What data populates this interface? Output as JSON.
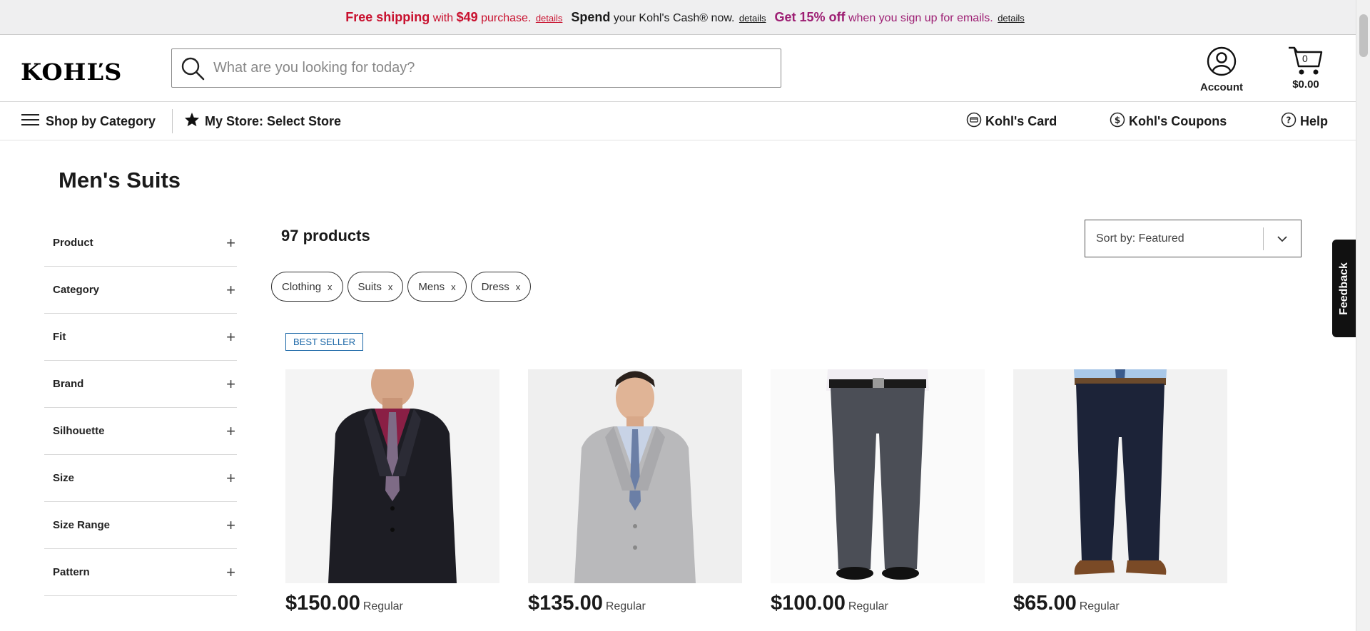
{
  "promo": {
    "seg1_strong": "Free shipping",
    "seg1_mid": "with",
    "seg1_amount": "$49",
    "seg1_end": "purchase.",
    "seg1_link": "details",
    "seg2_strong": "Spend",
    "seg2_mid": "your Kohl's Cash® now.",
    "seg2_link": "details",
    "seg3_strong": "Get 15% off",
    "seg3_mid": "when you sign up for emails.",
    "seg3_link": "details"
  },
  "header": {
    "logo": "KOHĽS",
    "search_placeholder": "What are you looking for today?",
    "account_label": "Account",
    "cart_count": "0",
    "cart_total": "$0.00"
  },
  "nav": {
    "shop_by_category": "Shop by Category",
    "my_store": "My Store: Select Store",
    "kohls_card": "Kohl's Card",
    "kohls_coupons": "Kohl's Coupons",
    "help": "Help"
  },
  "page_title": "Men's Suits",
  "facets": [
    "Product",
    "Category",
    "Fit",
    "Brand",
    "Silhouette",
    "Size",
    "Size Range",
    "Pattern"
  ],
  "product_count": "97 products",
  "sort_label": "Sort by: Featured",
  "chips": [
    "Clothing",
    "Suits",
    "Mens",
    "Dress"
  ],
  "chip_remove": "x",
  "badge": "BEST SELLER",
  "products": [
    {
      "price": "$150.00",
      "price_type": "Regular"
    },
    {
      "price": "$135.00",
      "price_type": "Regular"
    },
    {
      "price": "$100.00",
      "price_type": "Regular"
    },
    {
      "price": "$65.00",
      "price_type": "Regular"
    }
  ],
  "feedback_label": "Feedback",
  "colors": {
    "promo_red": "#c8102e",
    "promo_pink": "#9d1e73",
    "badge_blue": "#1a66a6"
  }
}
